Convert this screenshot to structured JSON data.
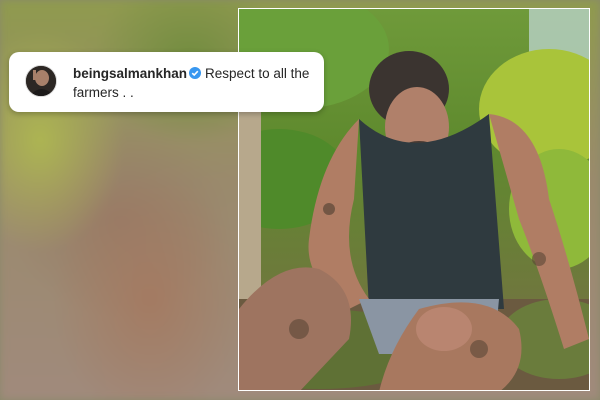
{
  "comment": {
    "username": "beingsalmankhan",
    "verified_icon": "verified-badge-icon",
    "text": "Respect to all the farmers . .",
    "badge_color": "#3897f0"
  },
  "photo": {
    "subject": "man-sitting-in-mud-field"
  }
}
